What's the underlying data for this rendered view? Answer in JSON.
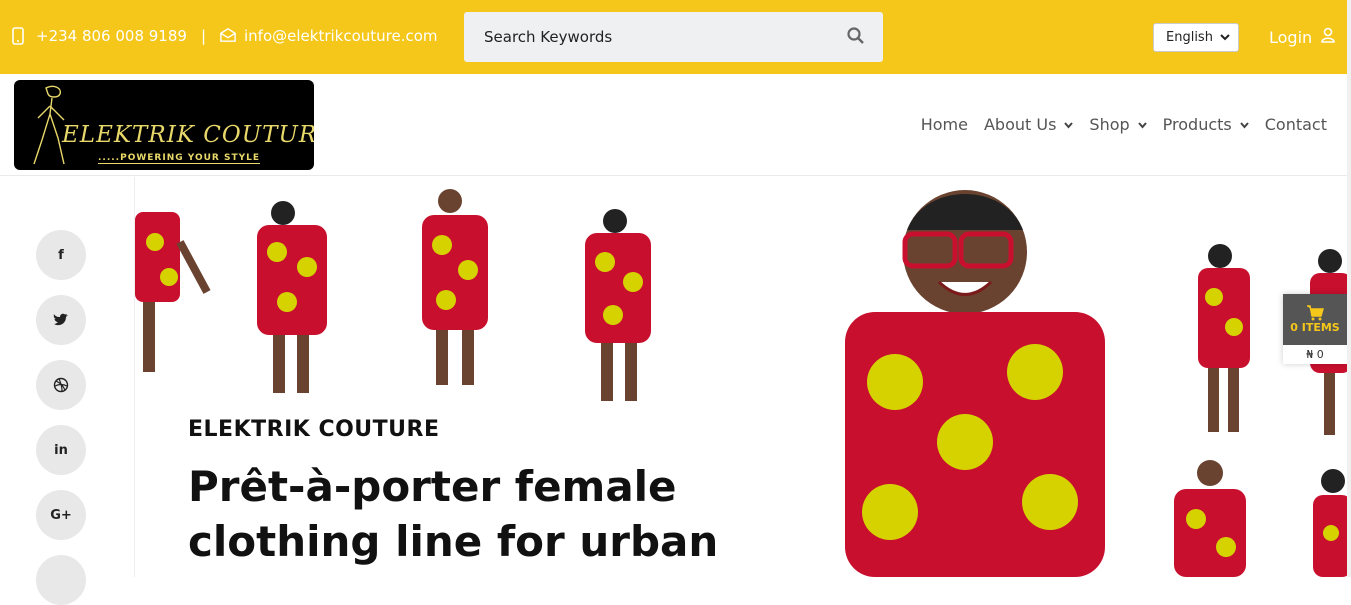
{
  "topbar": {
    "phone": "+234 806 008 9189",
    "separator": "|",
    "email": "info@elektrikcouture.com",
    "search_placeholder": "Search Keywords",
    "language": "English",
    "login_label": "Login"
  },
  "logo": {
    "brand": "ELEKTRIK COUTURE",
    "tagline": ".....POWERING YOUR STYLE"
  },
  "nav": {
    "items": [
      {
        "label": "Home"
      },
      {
        "label": "About Us"
      },
      {
        "label": "Shop"
      },
      {
        "label": "Products"
      },
      {
        "label": "Contact"
      }
    ]
  },
  "social": {
    "labels": [
      "f",
      "t",
      "d",
      "in",
      "G+"
    ]
  },
  "hero": {
    "brand": "ELEKTRIK COUTURE",
    "headline": "Prêt-à-porter female clothing line for urban outfits and a"
  },
  "cart": {
    "items_label": "0 ITEMS",
    "amount": "₦ 0"
  },
  "colors": {
    "accent": "#f5c71a",
    "dress_red": "#c8102e",
    "dress_yellow": "#d6d200"
  }
}
